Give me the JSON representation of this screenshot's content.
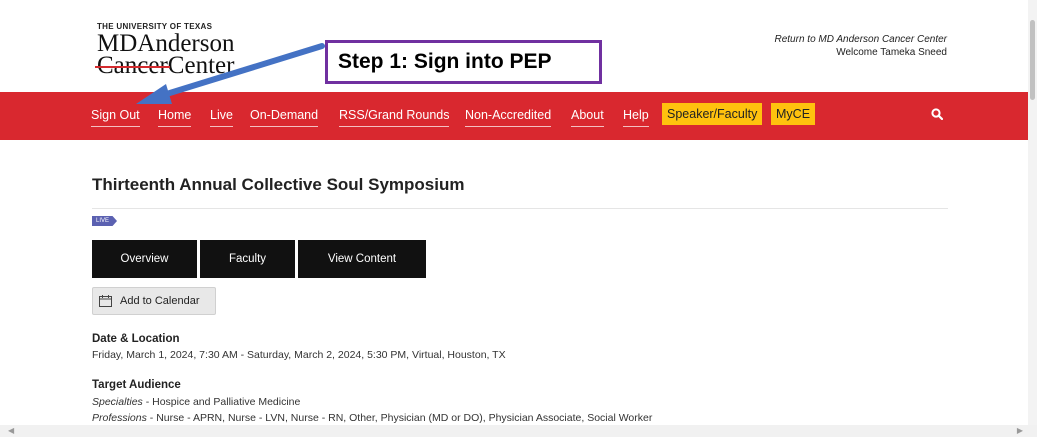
{
  "header": {
    "logo": {
      "university": "THE UNIVERSITY OF TEXAS",
      "line1": "MDAnderson",
      "line2a": "Cancer",
      "line2b": "Center"
    },
    "return_link": "Return to MD Anderson Cancer Center",
    "welcome": "Welcome Tameka Sneed"
  },
  "callout": {
    "text": "Step 1:  Sign into PEP",
    "border_color": "#7030a0",
    "arrow_color": "#4472c4"
  },
  "nav": {
    "bg_color": "#d9282f",
    "items": [
      "Sign Out",
      "Home",
      "Live",
      "On-Demand",
      "RSS/Grand Rounds",
      "Non-Accredited",
      "About",
      "Help",
      "Speaker/Faculty",
      "MyCE"
    ],
    "highlight_color": "#ffc20e",
    "search_icon": "search-icon"
  },
  "event": {
    "title": "Thirteenth Annual Collective Soul Symposium",
    "badge": "LIVE",
    "tabs": [
      "Overview",
      "Faculty",
      "View Content"
    ],
    "add_to_calendar": "Add to Calendar",
    "date_location_head": "Date & Location",
    "date_location": "Friday, March 1, 2024, 7:30 AM - Saturday, March 2, 2024, 5:30 PM, Virtual, Houston, TX",
    "target_head": "Target Audience",
    "specialties_label": "Specialties",
    "specialties": " - Hospice and Palliative Medicine",
    "professions_label": "Professions",
    "professions": " - Nurse - APRN, Nurse - LVN, Nurse - RN, Other, Physician (MD or DO), Physician Associate, Social Worker"
  }
}
